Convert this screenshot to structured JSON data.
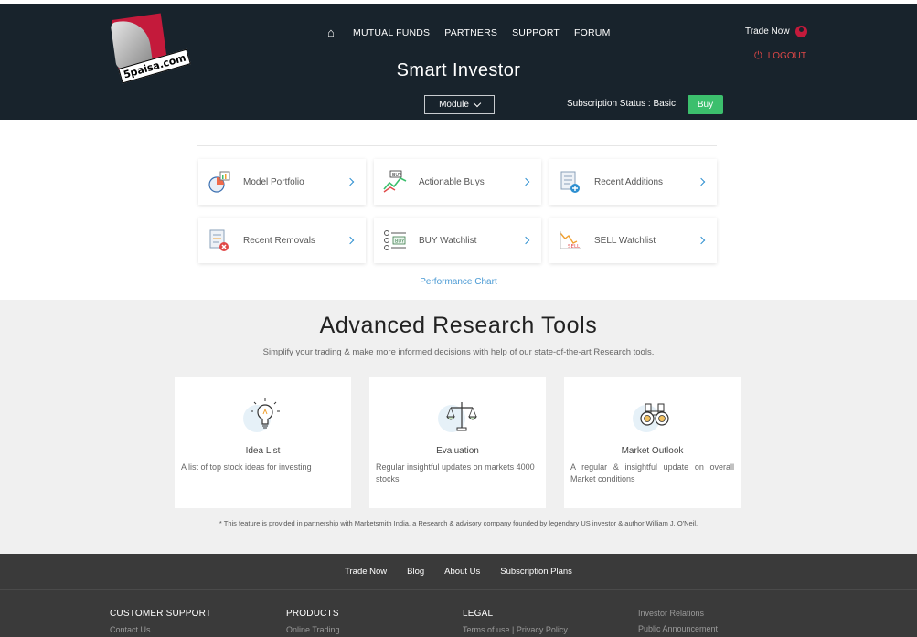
{
  "header": {
    "logo_text": "5paisa.com",
    "nav": [
      "MUTUAL FUNDS",
      "PARTNERS",
      "SUPPORT",
      "FORUM"
    ],
    "trade_now": "Trade Now",
    "logout": "LOGOUT",
    "title": "Smart Investor",
    "module_select": "Module",
    "subscription_status": "Subscription Status : Basic",
    "buy": "Buy"
  },
  "modules": [
    {
      "label": "Model Portfolio",
      "icon": "pie-chart-icon"
    },
    {
      "label": "Actionable Buys",
      "icon": "trend-up-icon"
    },
    {
      "label": "Recent Additions",
      "icon": "doc-add-icon"
    },
    {
      "label": "Recent Removals",
      "icon": "doc-remove-icon"
    },
    {
      "label": "BUY Watchlist",
      "icon": "buy-list-icon"
    },
    {
      "label": "SELL Watchlist",
      "icon": "sell-chart-icon"
    }
  ],
  "performance_chart": "Performance Chart",
  "research": {
    "heading": "Advanced Research Tools",
    "subheading": "Simplify your trading & make more informed decisions with help of our state-of-the-art Research tools.",
    "cards": [
      {
        "title": "Idea List",
        "desc": "A list of top stock ideas for investing",
        "icon": "lightbulb-icon"
      },
      {
        "title": "Evaluation",
        "desc": "Regular insightful updates on markets 4000 stocks",
        "icon": "scale-icon"
      },
      {
        "title": "Market Outlook",
        "desc": "A regular & insightful update on overall Market conditions",
        "icon": "binoculars-icon"
      }
    ],
    "note": "* This feature is provided in partnership with Marketsmith India, a Research & advisory company founded by legendary US investor & author William J. O'Neil."
  },
  "footer": {
    "links": [
      "Trade Now",
      "Blog",
      "About Us",
      "Subscription Plans"
    ],
    "customer_support": {
      "heading": "CUSTOMER SUPPORT",
      "items": [
        "Contact Us"
      ]
    },
    "products": {
      "heading": "PRODUCTS",
      "items": [
        "Online Trading"
      ]
    },
    "legal": {
      "heading": "LEGAL",
      "items": [
        "Terms of use | Privacy Policy"
      ]
    },
    "other": [
      "Investor Relations",
      "Public Announcement"
    ]
  },
  "colors": {
    "header_bg": "#18232c",
    "buy": "#3cbf6d",
    "logout": "#e04848",
    "link": "#4a9ad4",
    "footer_bg": "#3a3a3a"
  }
}
